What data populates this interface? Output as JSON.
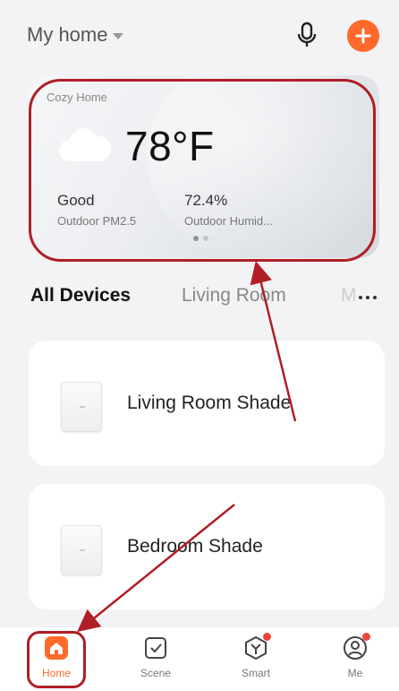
{
  "header": {
    "home_title": "My home",
    "mic_icon": "microphone-icon",
    "add_icon": "plus-icon"
  },
  "weather_card": {
    "label": "Cozy Home",
    "icon": "cloud-icon",
    "temperature": "78°F",
    "stats": [
      {
        "value": "Good",
        "label": "Outdoor PM2.5"
      },
      {
        "value": "72.4%",
        "label": "Outdoor Humid..."
      }
    ],
    "pages": 2,
    "active_page": 1
  },
  "tabs": {
    "items": [
      {
        "label": "All Devices",
        "active": true
      },
      {
        "label": "Living Room",
        "active": false
      },
      {
        "label": "M",
        "active": false
      }
    ],
    "more_icon": "more-dots-icon"
  },
  "devices": [
    {
      "name": "Living Room Shade",
      "icon": "shade-icon"
    },
    {
      "name": "Bedroom Shade",
      "icon": "shade-icon"
    }
  ],
  "bottom_nav": [
    {
      "label": "Home",
      "icon": "home-icon",
      "active": true
    },
    {
      "label": "Scene",
      "icon": "checkbox-icon",
      "active": false
    },
    {
      "label": "Smart",
      "icon": "smart-icon",
      "active": false
    },
    {
      "label": "Me",
      "icon": "user-icon",
      "active": false
    }
  ],
  "colors": {
    "accent": "#ff6a2b",
    "annotation": "#b01e26",
    "badge": "#e8463a"
  }
}
